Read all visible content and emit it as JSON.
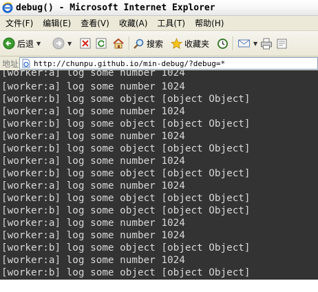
{
  "window": {
    "title": "debug() - Microsoft Internet Explorer"
  },
  "menu": [
    "文件(F)",
    "编辑(E)",
    "查看(V)",
    "收藏(A)",
    "工具(T)",
    "帮助(H)"
  ],
  "toolbar": {
    "back_label": "后退",
    "search_label": "搜索",
    "favorites_label": "收藏夹"
  },
  "address": {
    "label": "地址(D)",
    "url": "http://chunpu.github.io/min-debug/?debug=*"
  },
  "console_lines": [
    "[worker:a] log some number 1024",
    "[worker:a] log some number 1024",
    "[worker:b] log some object [object Object]",
    "[worker:a] log some number 1024",
    "[worker:b] log some object [object Object]",
    "[worker:a] log some number 1024",
    "[worker:b] log some object [object Object]",
    "[worker:a] log some number 1024",
    "[worker:b] log some object [object Object]",
    "[worker:a] log some number 1024",
    "[worker:b] log some object [object Object]",
    "[worker:b] log some object [object Object]",
    "[worker:a] log some number 1024",
    "[worker:a] log some number 1024",
    "[worker:b] log some object [object Object]",
    "[worker:a] log some number 1024",
    "[worker:b] log some object [object Object]"
  ],
  "colors": {
    "console_bg": "#333333",
    "console_text": "#d8d8d8",
    "chrome_bg": "#ece9d8"
  }
}
